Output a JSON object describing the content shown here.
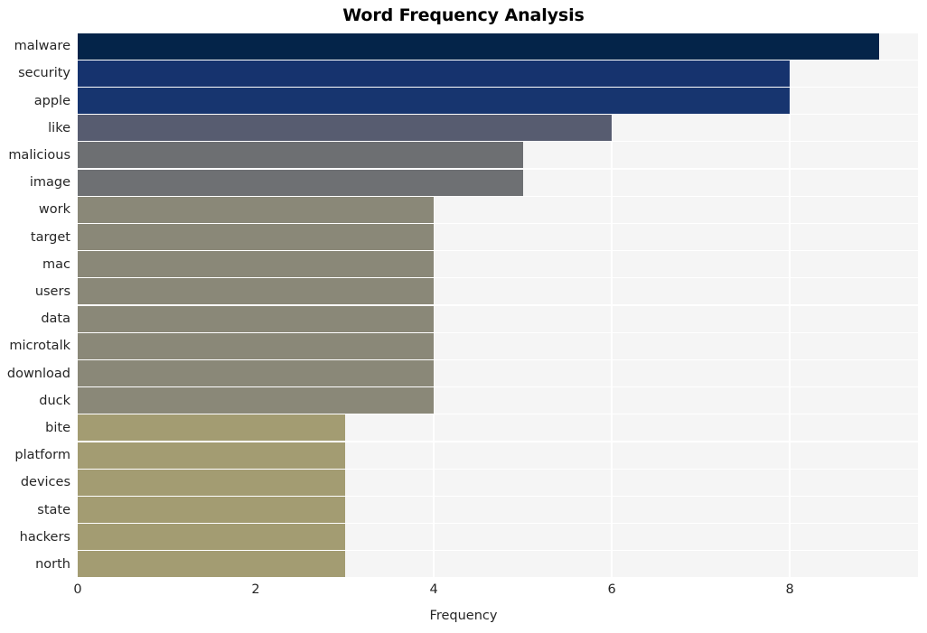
{
  "chart_data": {
    "type": "bar",
    "orientation": "horizontal",
    "title": "Word Frequency Analysis",
    "xlabel": "Frequency",
    "ylabel": "",
    "categories": [
      "malware",
      "security",
      "apple",
      "like",
      "malicious",
      "image",
      "work",
      "target",
      "mac",
      "users",
      "data",
      "microtalk",
      "download",
      "duck",
      "bite",
      "platform",
      "devices",
      "state",
      "hackers",
      "north"
    ],
    "values": [
      9,
      8,
      8,
      6,
      5,
      5,
      4,
      4,
      4,
      4,
      4,
      4,
      4,
      4,
      3,
      3,
      3,
      3,
      3,
      3
    ],
    "bar_colors": [
      "#042449",
      "#16336e",
      "#17356f",
      "#575c70",
      "#6d6f72",
      "#6e7073",
      "#8a8878",
      "#8a8878",
      "#8a8878",
      "#8a8878",
      "#8a8878",
      "#8a8878",
      "#8a8878",
      "#8a8878",
      "#a39c72",
      "#a39c72",
      "#a39c72",
      "#a39c72",
      "#a39c72",
      "#a39c72"
    ],
    "xlim": [
      0,
      9.44
    ],
    "ylim_count": 20,
    "xticks": [
      0,
      2,
      4,
      6,
      8
    ],
    "xtick_labels": [
      "0",
      "2",
      "4",
      "6",
      "8"
    ],
    "grid": true,
    "grid_color": "#ffffff",
    "plot_background": "#f5f5f5",
    "figure_background": "#ffffff",
    "legend": null,
    "annotations": []
  }
}
